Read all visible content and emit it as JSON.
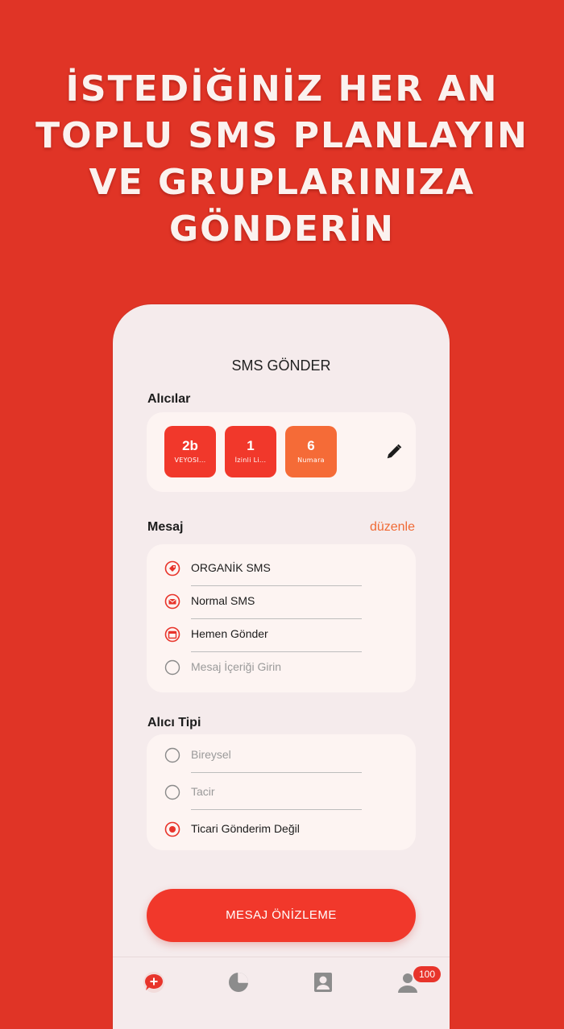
{
  "headline": {
    "lines": [
      "İSTEDİĞİNİZ HER AN",
      "TOPLU SMS PLANLAYIN",
      "VE GRUPLARINIZA",
      "GÖNDERİN"
    ]
  },
  "screen": {
    "title": "SMS GÖNDER",
    "recipients": {
      "label": "Alıcılar",
      "tiles": [
        {
          "value": "2b",
          "label": "VEYOSI...",
          "color": "#f1382b"
        },
        {
          "value": "1",
          "label": "İzinli Li...",
          "color": "#f1382b"
        },
        {
          "value": "6",
          "label": "Numara",
          "color": "#f56b37"
        }
      ],
      "edit_icon": "pencil-icon"
    },
    "message": {
      "label": "Mesaj",
      "edit_link": "düzenle",
      "items": [
        {
          "icon": "tag-icon",
          "text": "ORGANİK SMS"
        },
        {
          "icon": "envelope-icon",
          "text": "Normal SMS"
        },
        {
          "icon": "calendar-icon",
          "text": "Hemen Gönder"
        },
        {
          "icon": "radio-empty-icon",
          "text": "Mesaj İçeriği Girin"
        }
      ]
    },
    "recipient_type": {
      "label": "Alıcı Tipi",
      "options": [
        {
          "text": "Bireysel",
          "selected": false
        },
        {
          "text": "Tacir",
          "selected": false
        },
        {
          "text": "Ticari Gönderim Değil",
          "selected": true
        }
      ]
    },
    "preview_button": "MESAJ ÖNİZLEME",
    "tabbar": {
      "tabs": [
        "new-message-icon",
        "pie-chart-icon",
        "contact-icon",
        "user-icon"
      ],
      "badge": "100"
    },
    "colors": {
      "accent": "#f1382b",
      "accent_light": "#f56b37",
      "link": "#f06a35",
      "background": "#e03426"
    }
  }
}
